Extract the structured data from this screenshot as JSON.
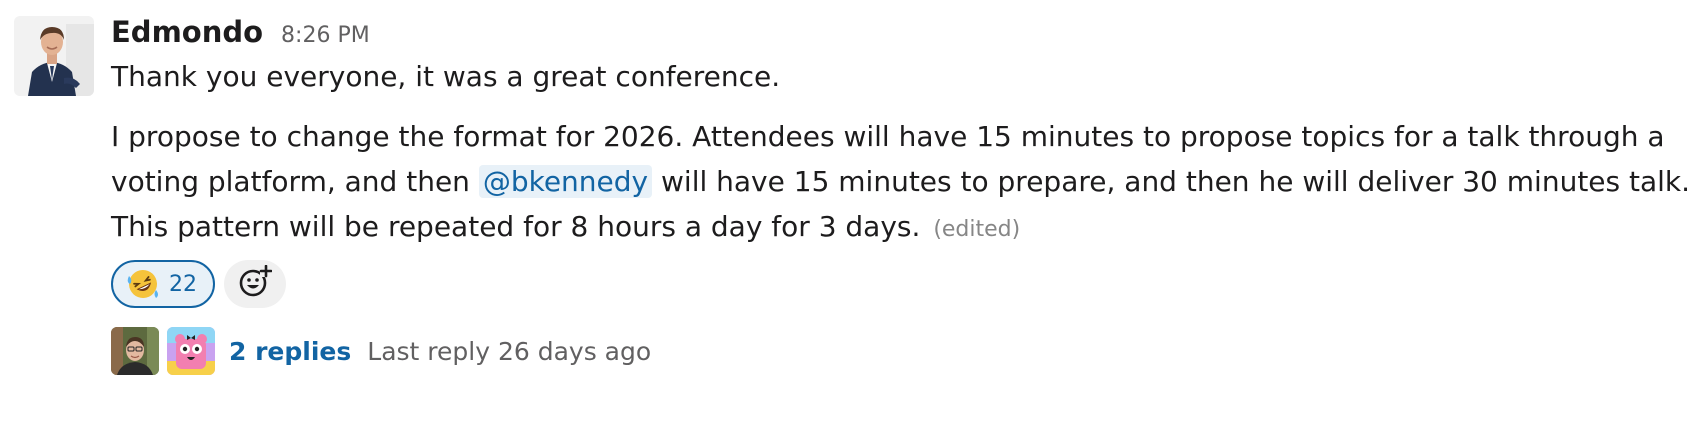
{
  "message": {
    "sender": "Edmondo",
    "timestamp": "8:26 PM",
    "paragraph1": "Thank you everyone, it was a great conference.",
    "paragraph2_before_mention": "I propose to change the format for 2026. Attendees will have 15 minutes to propose topics for a talk through a voting platform, and then ",
    "mention": "@bkennedy",
    "paragraph2_after_mention": " will have 15 minutes to prepare, and then he will deliver 30 minutes talk. This pattern will be repeated for 8 hours a day for 3 days.",
    "edited_label": "(edited)"
  },
  "reactions": [
    {
      "emoji": "rolling-on-the-floor-laughing-icon",
      "count": "22"
    }
  ],
  "add_reaction_icon": "add-reaction-icon",
  "thread": {
    "reply_count_label": "2 replies",
    "last_reply_label": "Last reply 26 days ago"
  },
  "colors": {
    "link": "#1264a3",
    "mention_bg": "#e8f1f8",
    "muted": "#616061"
  }
}
